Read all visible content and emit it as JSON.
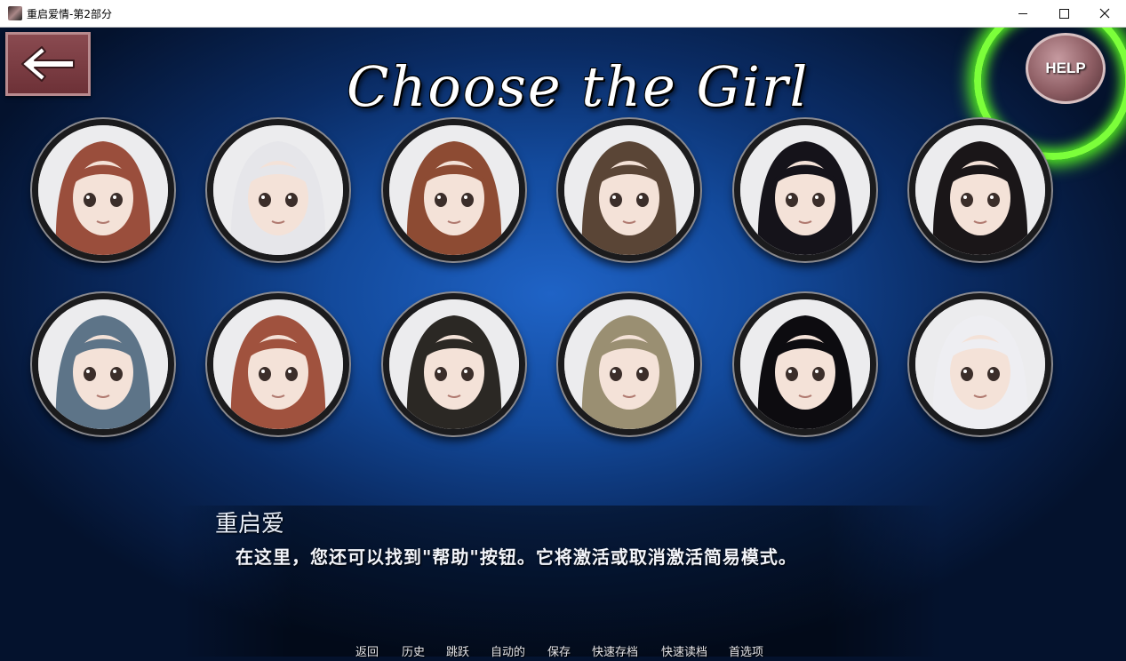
{
  "window": {
    "title": "重启爱情-第2部分",
    "icon": "app-icon",
    "controls": [
      "minimize-icon",
      "maximize-icon",
      "close-icon"
    ]
  },
  "header": {
    "back_icon": "arrow-left-icon",
    "title": "Choose the Girl",
    "help_label": "HELP",
    "help_highlight_color": "#7cff3a"
  },
  "portraits": [
    {
      "hair": "#9a4e3c",
      "name": "girl-1"
    },
    {
      "hair": "#e6e6ea",
      "name": "girl-2"
    },
    {
      "hair": "#8d4b33",
      "name": "girl-3"
    },
    {
      "hair": "#5a4536",
      "name": "girl-4"
    },
    {
      "hair": "#15131a",
      "name": "girl-5"
    },
    {
      "hair": "#1a1618",
      "name": "girl-6"
    },
    {
      "hair": "#5d7488",
      "name": "girl-7"
    },
    {
      "hair": "#a0523e",
      "name": "girl-8"
    },
    {
      "hair": "#2b2824",
      "name": "girl-9"
    },
    {
      "hair": "#9a8f72",
      "name": "girl-10"
    },
    {
      "hair": "#0d0c10",
      "name": "girl-11"
    },
    {
      "hair": "#eeeef2",
      "name": "girl-12"
    }
  ],
  "dialogue": {
    "speaker": "重启爱",
    "text": "在这里，您还可以找到\"帮助\"按钮。它将激活或取消激活简易模式。"
  },
  "quick_menu": {
    "back": "返回",
    "history": "历史",
    "skip": "跳跃",
    "auto": "自动的",
    "save": "保存",
    "quick_save": "快速存档",
    "quick_load": "快速读档",
    "prefs": "首选项"
  },
  "colors": {
    "background": "#134a9c",
    "back_button": "#7a3d43"
  }
}
